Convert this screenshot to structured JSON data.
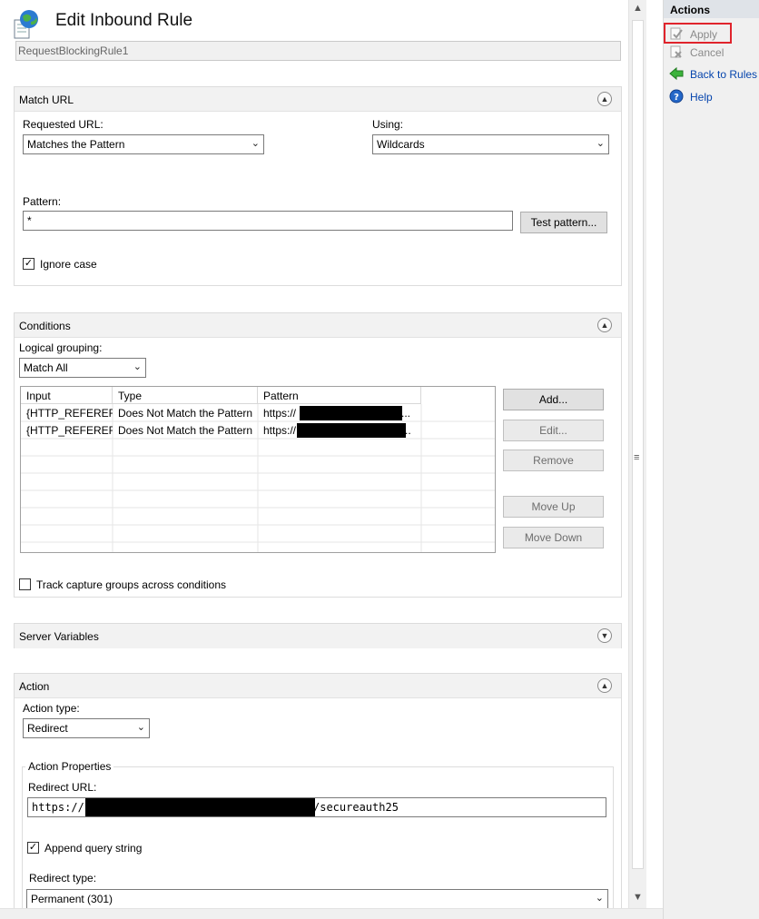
{
  "page": {
    "title": "Edit Inbound Rule",
    "rule_name": "RequestBlockingRule1"
  },
  "icons": {
    "page_icon": "globe-document-icon",
    "collapse": "chevron-up-icon",
    "expand": "chevron-down-icon"
  },
  "match_url": {
    "title": "Match URL",
    "requested_url_label": "Requested URL:",
    "requested_url_value": "Matches the Pattern",
    "using_label": "Using:",
    "using_value": "Wildcards",
    "pattern_label": "Pattern:",
    "pattern_value": "*",
    "test_pattern_label": "Test pattern...",
    "ignore_case_label": "Ignore case"
  },
  "conditions": {
    "title": "Conditions",
    "logical_grouping_label": "Logical grouping:",
    "logical_grouping_value": "Match All",
    "columns": [
      "Input",
      "Type",
      "Pattern"
    ],
    "rows": [
      {
        "input": "{HTTP_REFERER}",
        "type": "Does Not Match the Pattern",
        "pattern_prefix": "https://",
        "pattern_suffix": "..."
      },
      {
        "input": "{HTTP_REFERER}",
        "type": "Does Not Match the Pattern",
        "pattern_prefix": "https://",
        "pattern_suffix": ".."
      }
    ],
    "buttons": {
      "add": "Add...",
      "edit": "Edit...",
      "remove": "Remove",
      "move_up": "Move Up",
      "move_down": "Move Down"
    },
    "track_label": "Track capture groups across conditions"
  },
  "server_variables": {
    "title": "Server Variables"
  },
  "action": {
    "title": "Action",
    "action_type_label": "Action type:",
    "action_type_value": "Redirect",
    "properties_title": "Action Properties",
    "redirect_url_label": "Redirect URL:",
    "redirect_url_prefix": "https://",
    "redirect_url_suffix": "/secureauth25",
    "append_query_label": "Append query string",
    "redirect_type_label": "Redirect type:",
    "redirect_type_value": "Permanent (301)"
  },
  "actions_pane": {
    "title": "Actions",
    "items": [
      {
        "label": "Apply",
        "icon": "apply-icon"
      },
      {
        "label": "Cancel",
        "icon": "cancel-icon"
      },
      {
        "label": "Back to Rules",
        "icon": "back-arrow-icon"
      },
      {
        "label": "Help",
        "icon": "help-icon"
      }
    ],
    "highlight_color": "#e0242c"
  }
}
